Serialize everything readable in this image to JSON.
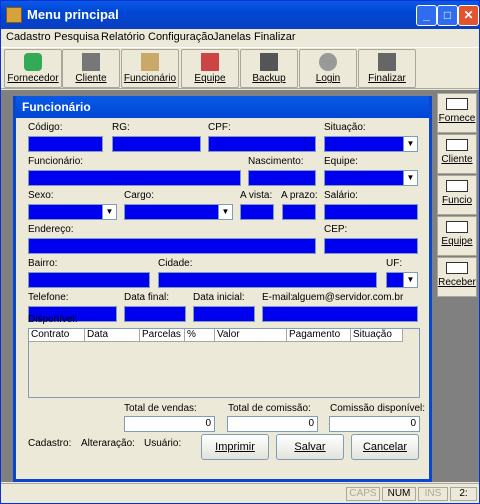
{
  "window": {
    "title": "Menu principal",
    "min": "_",
    "max": "□",
    "close": "✕"
  },
  "menu": [
    "Cadastro",
    "Pesquisa",
    "Relatório",
    "Configuração",
    "Janelas",
    "Finalizar"
  ],
  "toolbar": [
    {
      "label": "Fornecedor",
      "icon": "handshake-icon"
    },
    {
      "label": "Cliente",
      "icon": "mailbox-icon"
    },
    {
      "label": "Funcionário",
      "icon": "briefcase-icon"
    },
    {
      "label": "Equipe",
      "icon": "people-icon"
    },
    {
      "label": "Backup",
      "icon": "disk-icon"
    },
    {
      "label": "Login",
      "icon": "padlock-icon"
    },
    {
      "label": "Finalizar",
      "icon": "floppy-icon"
    }
  ],
  "form": {
    "title": "Funcionário",
    "labels": {
      "codigo": "Código:",
      "rg": "RG:",
      "cpf": "CPF:",
      "situacao": "Situação:",
      "funcionario": "Funcionário:",
      "nascimento": "Nascimento:",
      "equipe": "Equipe:",
      "sexo": "Sexo:",
      "cargo": "Cargo:",
      "avista": "A vista:",
      "aprazo": "A prazo:",
      "salario": "Salário:",
      "endereco": "Endereço:",
      "cep": "CEP:",
      "bairro": "Bairro:",
      "cidade": "Cidade:",
      "uf": "UF:",
      "telefone": "Telefone:",
      "datafinal": "Data final:",
      "datainicial": "Data inicial:",
      "email": "E-mail:",
      "disponivel": "Disponível:"
    },
    "email_value": "alguem@servidor.com.br",
    "grid_columns": [
      "Contrato",
      "Data",
      "Parcelas",
      "%",
      "Valor",
      "Pagamento",
      "Situação"
    ],
    "totals": {
      "vendas_label": "Total de vendas:",
      "vendas": "0",
      "comissao_label": "Total de comissão:",
      "comissao": "0",
      "disp_label": "Comissão disponível:",
      "disp": "0"
    },
    "footer": {
      "cadastro": "Cadastro:",
      "alteracao": "Alteraração:",
      "usuario": "Usuário:"
    },
    "buttons": {
      "imprimir": "Imprimir",
      "salvar": "Salvar",
      "cancelar": "Cancelar"
    },
    "field_color": "#0000f0"
  },
  "side": [
    "Fornece",
    "Cliente",
    "Funcio",
    "Equipe",
    "Receber"
  ],
  "status": [
    "CAPS",
    "NUM",
    "INS",
    "2:"
  ]
}
